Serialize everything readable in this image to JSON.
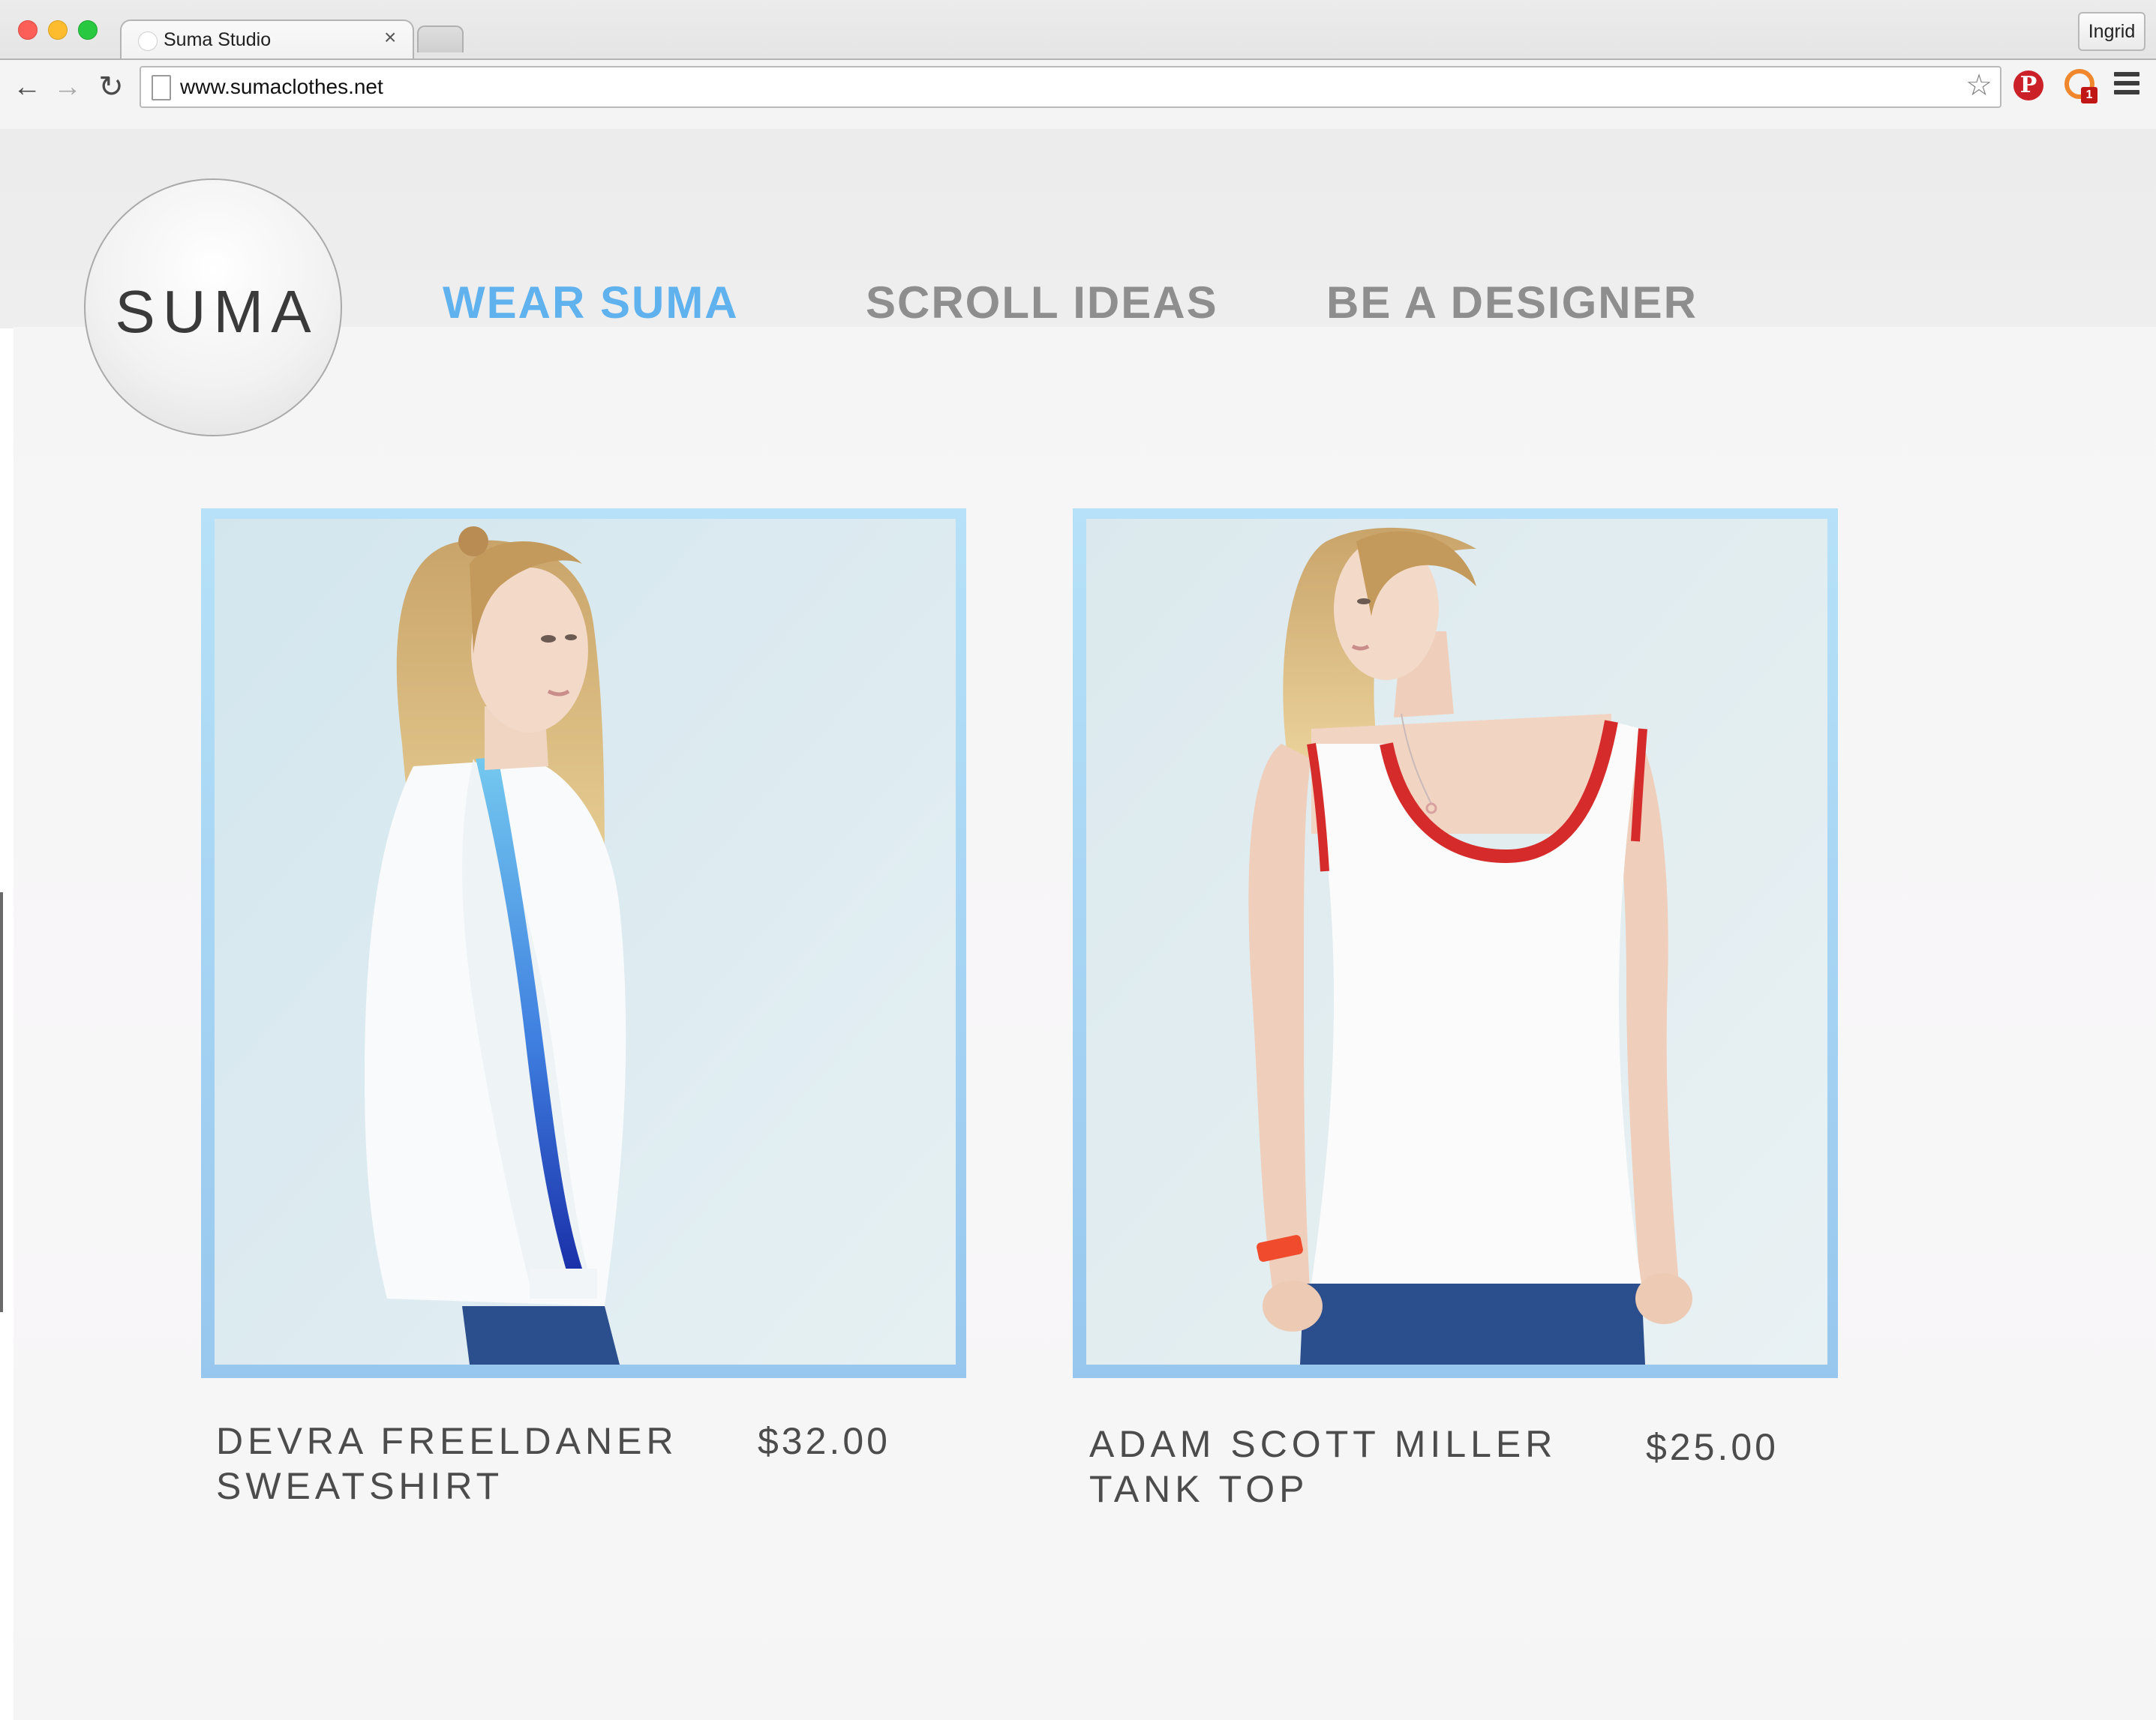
{
  "browser": {
    "tab_title": "Suma Studio",
    "tab_close": "×",
    "profile_name": "Ingrid",
    "url": "www.sumaclothes.net",
    "extension_badge": "1",
    "pinterest_glyph": "P",
    "icons": [
      "back-arrow-icon",
      "forward-arrow-icon",
      "reload-icon",
      "page-icon",
      "star-icon",
      "pinterest-icon",
      "extension-icon",
      "menu-icon"
    ]
  },
  "site": {
    "logo": "SUMA",
    "nav": [
      {
        "label": "WEAR SUMA",
        "active": true
      },
      {
        "label": "SCROLL IDEAS",
        "active": false
      },
      {
        "label": "BE A DESIGNER",
        "active": false
      }
    ],
    "colors": {
      "accent": "#5fb2ed",
      "nav_inactive": "#8e8e8e",
      "frame": "#a8d6f4"
    }
  },
  "products": [
    {
      "name_line1": "DEVRA FREELDANER",
      "name_line2": "SWEATSHIRT",
      "price": "$32.00"
    },
    {
      "name_line1": "ADAM SCOTT MILLER",
      "name_line2": "TANK TOP",
      "price": "$25.00"
    }
  ]
}
